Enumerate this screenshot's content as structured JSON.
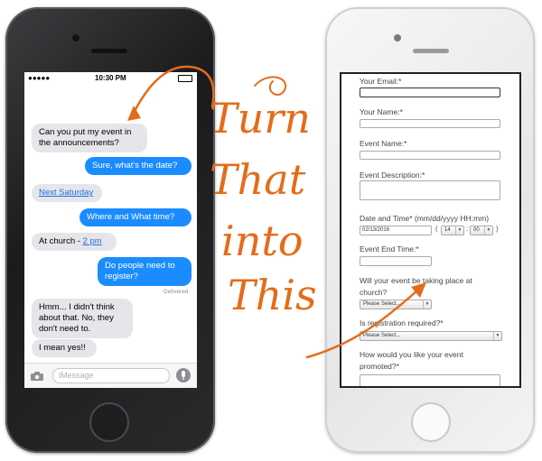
{
  "left_phone": {
    "status_time": "10:30 PM",
    "messages": [
      {
        "text": "Can you put my event in the announcements?",
        "dir": "in"
      },
      {
        "text": "Sure, what's the date?",
        "dir": "out"
      },
      {
        "text": "Next Saturday",
        "dir": "in"
      },
      {
        "text": "Where and What time?",
        "dir": "out"
      },
      {
        "text_prefix": "At church - ",
        "text_link": "2 pm",
        "dir": "in"
      },
      {
        "text": "Do people need to register?",
        "dir": "out"
      },
      {
        "text": "Hmm... I didn't think about that. No, they don't need to.",
        "dir": "in"
      },
      {
        "text": "I mean yes!!",
        "dir": "in"
      }
    ],
    "delivered": "Delivered",
    "input_placeholder": "iMessage"
  },
  "handwriting": {
    "line1": "Turn",
    "line2": "That",
    "line3": "into",
    "line4": "This"
  },
  "right_phone": {
    "fields": {
      "email_label": "Your Email:*",
      "name_label": "Your Name:*",
      "event_name_label": "Event Name:*",
      "event_desc_label": "Event Description:*",
      "datetime_label": "Date and Time* (mm/dd/yyyy HH:mm)",
      "date_value": "02/13/2016",
      "hour_value": "14",
      "minute_value": "00",
      "end_time_label": "Event End Time:*",
      "at_church_label_1": "Will your event be taking place at",
      "at_church_label_2": "church?",
      "at_church_select": "Please Select...",
      "registration_label": "Is registration required?*",
      "registration_select": "Please Select...",
      "promoted_label_1": "How would you like your event",
      "promoted_label_2": "promoted?*"
    }
  },
  "colors": {
    "accent": "#e36c1a",
    "bubble_out": "#1a8cff",
    "bubble_in": "#e5e5ea"
  }
}
